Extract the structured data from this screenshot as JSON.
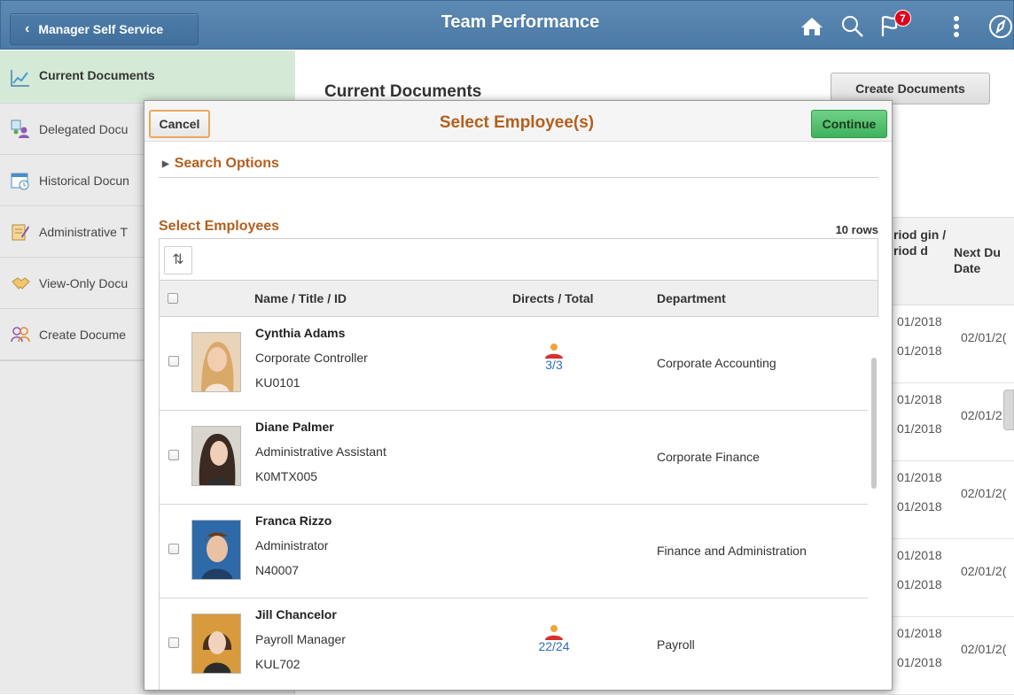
{
  "banner": {
    "back_label": "Manager Self Service",
    "title": "Team Performance",
    "notification_count": "7"
  },
  "sidebar": {
    "items": [
      {
        "label": "Current Documents",
        "icon": "line-chart-icon",
        "active": true
      },
      {
        "label": "Delegated Docu",
        "icon": "delegated-users-icon"
      },
      {
        "label": "Historical Docun",
        "icon": "calendar-clock-icon"
      },
      {
        "label": "Administrative T",
        "icon": "notepad-icon"
      },
      {
        "label": "View-Only Docu",
        "icon": "handshake-icon"
      },
      {
        "label": "Create Docume",
        "icon": "people-icon"
      }
    ]
  },
  "main": {
    "title": "Current Documents",
    "create_button": "Create Documents",
    "col1_header": "riod gin / riod d",
    "col2_header": "Next Du Date",
    "rows": [
      {
        "d1": "01/2018",
        "d2": "01/2018",
        "d3": "02/01/2("
      },
      {
        "d1": "01/2018",
        "d2": "01/2018",
        "d3": "02/01/2"
      },
      {
        "d1": "01/2018",
        "d2": "01/2018",
        "d3": "02/01/2("
      },
      {
        "d1": "01/2018",
        "d2": "01/2018",
        "d3": "02/01/2("
      },
      {
        "d1": "01/2018",
        "d2": "01/2018",
        "d3": "02/01/2("
      }
    ]
  },
  "modal": {
    "cancel_label": "Cancel",
    "title": "Select Employee(s)",
    "continue_label": "Continue",
    "search_options_label": "Search Options",
    "section_title": "Select Employees",
    "rows_count": "10 rows",
    "columns": {
      "name": "Name / Title / ID",
      "directs": "Directs / Total",
      "department": "Department"
    },
    "employees": [
      {
        "name": "Cynthia Adams",
        "title": "Corporate Controller",
        "id": "KU0101",
        "directs": "3/3",
        "department": "Corporate Accounting"
      },
      {
        "name": "Diane Palmer",
        "title": "Administrative Assistant",
        "id": "K0MTX005",
        "directs": "",
        "department": "Corporate Finance"
      },
      {
        "name": "Franca Rizzo",
        "title": "Administrator",
        "id": "N40007",
        "directs": "",
        "department": "Finance and Administration"
      },
      {
        "name": "Jill Chancelor",
        "title": "Payroll Manager",
        "id": "KUL702",
        "directs": "22/24",
        "department": "Payroll"
      }
    ]
  },
  "colors": {
    "banner": "#4f7eab",
    "section_title": "#b35f1d",
    "continue_green": "#4cbb68",
    "link_blue": "#2d6fbd",
    "active_nav": "#d4ead6"
  }
}
